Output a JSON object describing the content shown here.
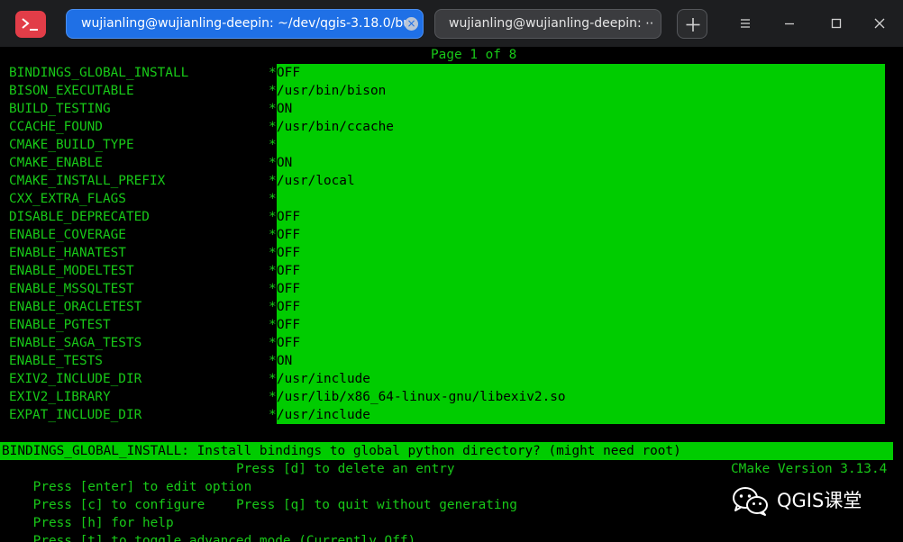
{
  "titlebar": {
    "tabs": [
      {
        "label": "wujianling@wujianling-deepin: ~/dev/qgis-3.18.0/buil…",
        "active": true
      },
      {
        "label": "wujianling@wujianling-deepin: ⋯",
        "active": false
      }
    ],
    "new_tab_icon": "plus-icon",
    "window_buttons": [
      "menu-icon",
      "minimize-icon",
      "maximize-icon",
      "close-icon"
    ]
  },
  "terminal": {
    "page_indicator": "Page 1 of 8",
    "options": [
      {
        "name": "BINDINGS_GLOBAL_INSTALL",
        "value": "OFF"
      },
      {
        "name": "BISON_EXECUTABLE",
        "value": "/usr/bin/bison"
      },
      {
        "name": "BUILD_TESTING",
        "value": "ON"
      },
      {
        "name": "CCACHE_FOUND",
        "value": "/usr/bin/ccache"
      },
      {
        "name": "CMAKE_BUILD_TYPE",
        "value": ""
      },
      {
        "name": "CMAKE_ENABLE",
        "value": "ON"
      },
      {
        "name": "CMAKE_INSTALL_PREFIX",
        "value": "/usr/local"
      },
      {
        "name": "CXX_EXTRA_FLAGS",
        "value": ""
      },
      {
        "name": "DISABLE_DEPRECATED",
        "value": "OFF"
      },
      {
        "name": "ENABLE_COVERAGE",
        "value": "OFF"
      },
      {
        "name": "ENABLE_HANATEST",
        "value": "OFF"
      },
      {
        "name": "ENABLE_MODELTEST",
        "value": "OFF"
      },
      {
        "name": "ENABLE_MSSQLTEST",
        "value": "OFF"
      },
      {
        "name": "ENABLE_ORACLETEST",
        "value": "OFF"
      },
      {
        "name": "ENABLE_PGTEST",
        "value": "OFF"
      },
      {
        "name": "ENABLE_SAGA_TESTS",
        "value": "OFF"
      },
      {
        "name": "ENABLE_TESTS",
        "value": "ON"
      },
      {
        "name": "EXIV2_INCLUDE_DIR",
        "value": "/usr/include"
      },
      {
        "name": "EXIV2_LIBRARY",
        "value": "/usr/lib/x86_64-linux-gnu/libexiv2.so"
      },
      {
        "name": "EXPAT_INCLUDE_DIR",
        "value": "/usr/include"
      }
    ],
    "modified_marker": "*",
    "help_text": "BINDINGS_GLOBAL_INSTALL: Install bindings to global python directory? (might need root)",
    "footer": {
      "line1_left": "Press [enter] to edit option",
      "line1_right": "Press [d] to delete an entry",
      "line2_left": "Press [c] to configure",
      "line3_left": "Press [h] for help",
      "line3_right": "Press [q] to quit without generating",
      "line4_left": "Press [t] to toggle advanced mode (Currently Off)",
      "version": "CMake Version 3.13.4"
    }
  },
  "watermark": {
    "icon": "wechat-icon",
    "text": "QGIS课堂"
  },
  "colors": {
    "terminal_bg": "#000000",
    "terminal_fg": "#18c818",
    "highlight": "#00cc00",
    "titlebar_bg": "#1d1e20",
    "active_tab": "#1f70e6",
    "app_icon": "#e23d48"
  }
}
